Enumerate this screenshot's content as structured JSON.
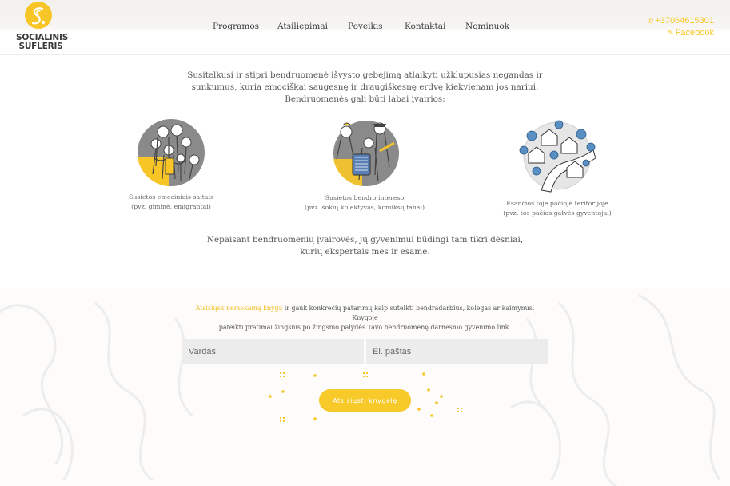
{
  "brand": {
    "line1": "SOCIALINIS",
    "line2": "SUFLERIS"
  },
  "nav": {
    "items": [
      {
        "label": "Programos"
      },
      {
        "label": "Atsiliepimai"
      },
      {
        "label": "Poveikis"
      },
      {
        "label": "Kontaktai"
      },
      {
        "label": "Nominuok"
      }
    ]
  },
  "contact": {
    "phone": "+37064615301",
    "facebook": "Facebook"
  },
  "intro": {
    "line1": "Susitelkusi ir stipri bendruomenė išvysto gebėjimą atlaikyti užklupusias negandas ir",
    "line2": "sunkumus, kuria emociškai saugesnę ir draugiškesnę erdvę kiekvienam jos nariui.",
    "line3": "Bendruomenės gali būti labai įvairios:"
  },
  "types": [
    {
      "title": "Susietos emociniais saitais",
      "subtitle": "(pvz. giminė, emigrantai)"
    },
    {
      "title": "Susietos bendro intereso",
      "subtitle": "(pvz. šokių kolektyvas, komiksų fanai)"
    },
    {
      "title": "Esančios toje pačioje teritorijoje",
      "subtitle": "(pvz. tos pačios gatvės gyventojai)"
    }
  ],
  "middle": {
    "line1": "Nepaisant bendruomenių įvairovės, jų gyvenimui būdingi tam tikri dėsniai,",
    "line2": "kurių ekspertais mes ir esame."
  },
  "offer": {
    "link": "Atsisiųsk nemokamą knygą",
    "text1": " ir gauk konkrečių patarimų kaip sutelkti bendradarbius, kolegas ar kaimynus. Knygoje",
    "text2": "pateikti pratimai žingsnis po žingsnio palydės Tavo bendruomenę darnesnio gyvenimo link."
  },
  "form": {
    "name_placeholder": "Vardas",
    "email_placeholder": "El. paštas",
    "submit_label": "Atsisiųsti knygelę"
  },
  "colors": {
    "accent": "#f7c929",
    "text": "#555555",
    "field": "#ececec"
  },
  "icons": [
    "logo-mark",
    "phone-icon",
    "facebook-icon",
    "family-illustration",
    "musicians-illustration",
    "houses-illustration",
    "sparkle-icon"
  ]
}
